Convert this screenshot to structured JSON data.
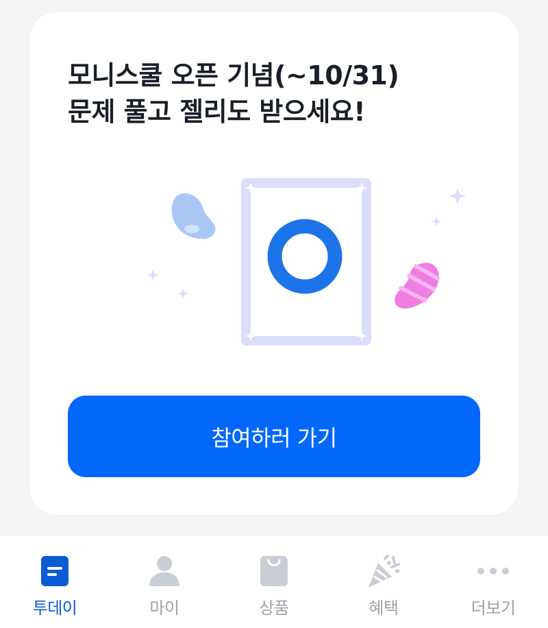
{
  "card": {
    "title_line1": "모니스쿨 오픈 기념(~10/31)",
    "title_line2": "문제 풀고 젤리도 받으세요!",
    "illustration": {
      "icon": "quiz-card-o-mark-icon",
      "decorations": [
        "blue-jelly-bean-icon",
        "pink-striped-jelly-bean-icon",
        "sparkle-icon"
      ]
    },
    "cta_label": "참여하러 가기"
  },
  "tabbar": {
    "tabs": [
      {
        "label": "투데이",
        "icon": "today-doc-icon",
        "active": true
      },
      {
        "label": "마이",
        "icon": "person-icon",
        "active": false
      },
      {
        "label": "상품",
        "icon": "shopping-bag-icon",
        "active": false
      },
      {
        "label": "혜택",
        "icon": "party-popper-icon",
        "active": false
      },
      {
        "label": "더보기",
        "icon": "more-dots-icon",
        "active": false
      }
    ]
  },
  "colors": {
    "primary": "#0368fa",
    "active_tab": "#0b5bd4",
    "inactive_tab": "#9aa1ab",
    "icon_inactive": "#c9ced6",
    "card_frame": "#dcdcfb",
    "o_mark": "#1d74e8",
    "blue_jelly": "#a9c6f5",
    "pink_jelly": "#f07de2",
    "background": "#f4f5f7"
  }
}
